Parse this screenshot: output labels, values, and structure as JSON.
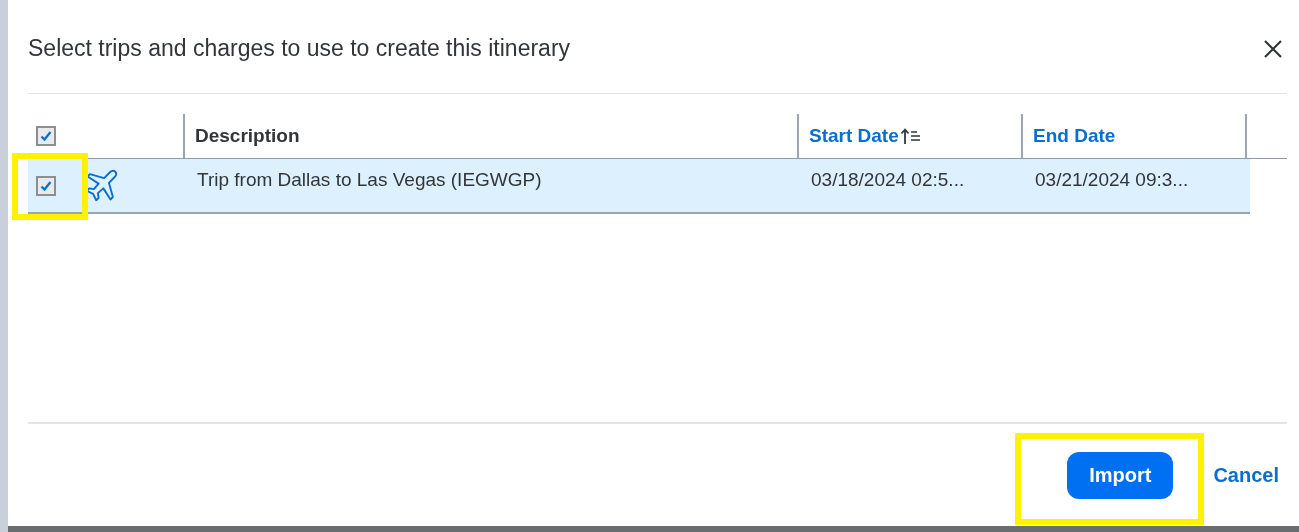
{
  "dialog": {
    "title": "Select trips and charges to use to create this itinerary"
  },
  "table": {
    "select_all": {
      "checked": true
    },
    "columns": [
      {
        "label": "Description",
        "kind": "plain",
        "sorted": false
      },
      {
        "label": "Start Date",
        "kind": "link",
        "sorted": true
      },
      {
        "label": "End Date",
        "kind": "link",
        "sorted": false
      }
    ],
    "rows": [
      {
        "checked": true,
        "selected": true,
        "highlighted": true,
        "kind": "flight",
        "description": "Trip from Dallas to Las Vegas (IEGWGP)",
        "start_date": "03/18/2024 02:5...",
        "end_date": "03/21/2024 09:3..."
      }
    ]
  },
  "buttons": [
    {
      "label": "Import",
      "kind": "primary",
      "highlighted": true
    },
    {
      "label": "Cancel",
      "kind": "link",
      "highlighted": false
    }
  ]
}
